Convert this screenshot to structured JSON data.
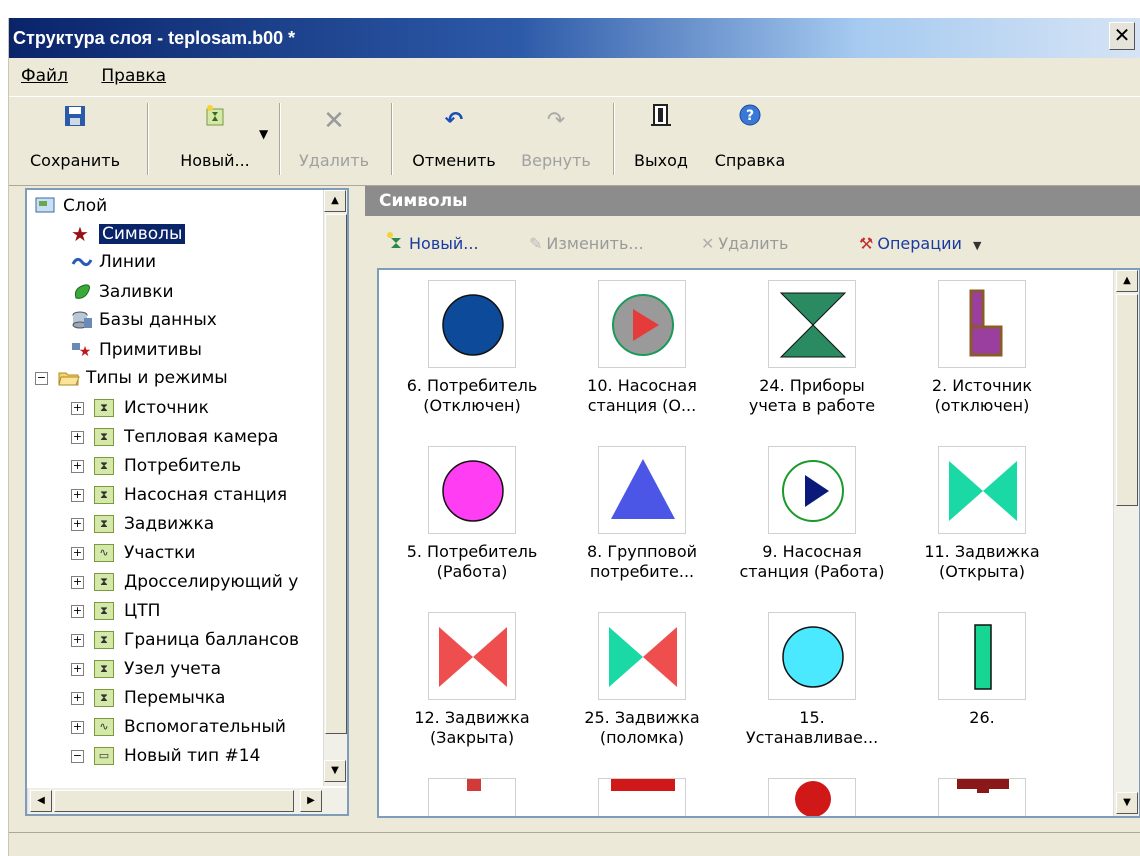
{
  "window": {
    "title": "Структура слоя - teplosam.b00 *",
    "close": "✕"
  },
  "menu": [
    "Файл",
    "Правка"
  ],
  "toolbar": {
    "save": "Сохранить",
    "new": "Новый...",
    "delete": "Удалить",
    "undo": "Отменить",
    "redo": "Вернуть",
    "exit": "Выход",
    "help": "Справка"
  },
  "tree": {
    "root": "Слой",
    "items": [
      "Символы",
      "Линии",
      "Заливки",
      "Базы данных",
      "Примитивы"
    ],
    "types_folder": "Типы и режимы",
    "types": [
      "Источник",
      "Тепловая камера",
      "Потребитель",
      "Насосная станция",
      "Задвижка",
      "Участки",
      "Дросселирующий у",
      "ЦТП",
      "Граница баллансов",
      "Узел учета",
      "Перемычка",
      "Вспомогательный",
      "Новый тип #14"
    ]
  },
  "panel": {
    "title": "Символы",
    "new": "Новый...",
    "edit": "Изменить...",
    "delete": "Удалить",
    "operations": "Операции"
  },
  "symbols": [
    {
      "line1": "6. Потребитель",
      "line2": "(Отключен)"
    },
    {
      "line1": "10. Насосная",
      "line2": "станция (О..."
    },
    {
      "line1": "24. Приборы",
      "line2": "учета в работе"
    },
    {
      "line1": "2. Источник",
      "line2": "(отключен)"
    },
    {
      "line1": "5. Потребитель",
      "line2": "(Работа)"
    },
    {
      "line1": "8. Групповой",
      "line2": "потребите..."
    },
    {
      "line1": "9. Насосная",
      "line2": "станция (Работа)"
    },
    {
      "line1": "11. Задвижка",
      "line2": "(Открыта)"
    },
    {
      "line1": "12. Задвижка",
      "line2": "(Закрыта)"
    },
    {
      "line1": "25. Задвижка",
      "line2": "(поломка)"
    },
    {
      "line1": "15.",
      "line2": "Устанавливае..."
    },
    {
      "line1": "26.",
      "line2": ""
    }
  ],
  "colors": {
    "consumer_off": "#0d4a9a",
    "consumer_on": "#ff3df2",
    "group": "#4b55e6",
    "pump_red": "#e53b3b",
    "pump_nav": "#0a1a7a",
    "valve_open": "#1bd9a4",
    "valve_closed": "#ef4e4e",
    "meter_green": "#2a8a62",
    "source_purple": "#9a3f9f",
    "source_brown": "#8b5a2b",
    "cyan": "#4be9ff",
    "bar": "#17d693"
  }
}
